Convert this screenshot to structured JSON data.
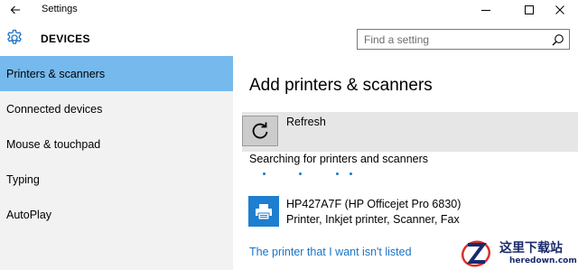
{
  "window": {
    "title": "Settings",
    "controls": [
      "minimize-icon",
      "maximize-icon",
      "close-icon"
    ]
  },
  "header": {
    "title": "DEVICES",
    "icon": "gear-icon",
    "search": {
      "placeholder": "Find a setting",
      "value": ""
    }
  },
  "sidebar": {
    "items": [
      {
        "label": "Printers & scanners",
        "selected": true
      },
      {
        "label": "Connected devices",
        "selected": false
      },
      {
        "label": "Mouse & touchpad",
        "selected": false
      },
      {
        "label": "Typing",
        "selected": false
      },
      {
        "label": "AutoPlay",
        "selected": false
      }
    ],
    "selected_color": "#76b9ed"
  },
  "main": {
    "section_title": "Add printers & scanners",
    "refresh": {
      "label": "Refresh",
      "icon": "refresh-icon"
    },
    "searching_label": "Searching for printers and scanners",
    "printer": {
      "name": "HP427A7F (HP Officejet Pro 6830)",
      "description": "Printer, Inkjet printer, Scanner, Fax",
      "icon": "printer-icon"
    },
    "not_listed_link": "The printer that I want isn't listed",
    "accent": "#1b74c5"
  },
  "watermark": {
    "cn": "这里下载站",
    "en": "heredown.com"
  }
}
